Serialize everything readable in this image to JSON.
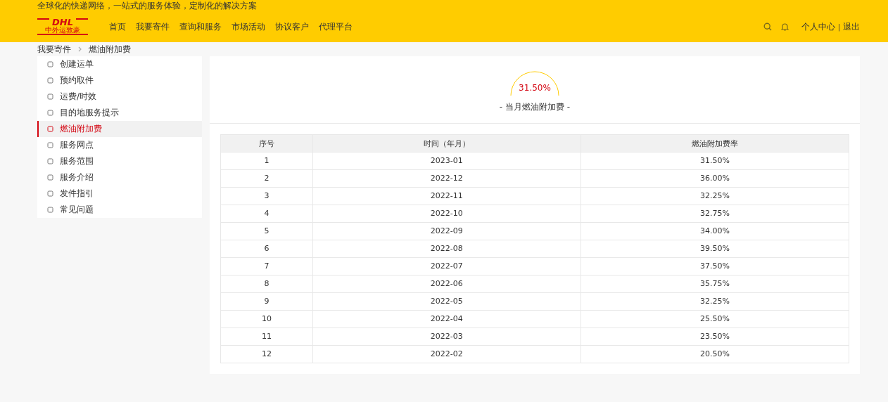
{
  "header": {
    "slogan": "全球化的快递网络，一站式的服务体验，定制化的解决方案",
    "logo": {
      "wordmark": "DHL",
      "subtitle": "中外运敦豪"
    },
    "nav": [
      {
        "label": "首页",
        "selected": false
      },
      {
        "label": "我要寄件",
        "selected": false
      },
      {
        "label": "查询和服务",
        "selected": false
      },
      {
        "label": "市场活动",
        "selected": false
      },
      {
        "label": "协议客户",
        "selected": false
      },
      {
        "label": "代理平台",
        "selected": false
      }
    ],
    "user_links": [
      "个人中心",
      "退出"
    ],
    "separator": "|"
  },
  "breadcrumb": [
    "我要寄件",
    "燃油附加费"
  ],
  "sidebar": {
    "items": [
      {
        "label": "创建运单",
        "selected": false
      },
      {
        "label": "预约取件",
        "selected": false
      },
      {
        "label": "运费/时效",
        "selected": false
      },
      {
        "label": "目的地服务提示",
        "selected": false
      },
      {
        "label": "燃油附加费",
        "selected": true
      },
      {
        "label": "服务网点",
        "selected": false
      },
      {
        "label": "服务范围",
        "selected": false
      },
      {
        "label": "服务介绍",
        "selected": false
      },
      {
        "label": "发件指引",
        "selected": false
      },
      {
        "label": "常见问题",
        "selected": false
      }
    ]
  },
  "gauge": {
    "value": "31.50%",
    "caption": "- 当月燃油附加费 -"
  },
  "table": {
    "columns": [
      "序号",
      "时间（年月）",
      "燃油附加费率"
    ],
    "rows": [
      [
        "1",
        "2023-01",
        "31.50%"
      ],
      [
        "2",
        "2022-12",
        "36.00%"
      ],
      [
        "3",
        "2022-11",
        "32.25%"
      ],
      [
        "4",
        "2022-10",
        "32.75%"
      ],
      [
        "5",
        "2022-09",
        "34.00%"
      ],
      [
        "6",
        "2022-08",
        "39.50%"
      ],
      [
        "7",
        "2022-07",
        "37.50%"
      ],
      [
        "8",
        "2022-06",
        "35.75%"
      ],
      [
        "9",
        "2022-05",
        "32.25%"
      ],
      [
        "10",
        "2022-04",
        "25.50%"
      ],
      [
        "11",
        "2022-03",
        "23.50%"
      ],
      [
        "12",
        "2022-02",
        "20.50%"
      ]
    ]
  }
}
